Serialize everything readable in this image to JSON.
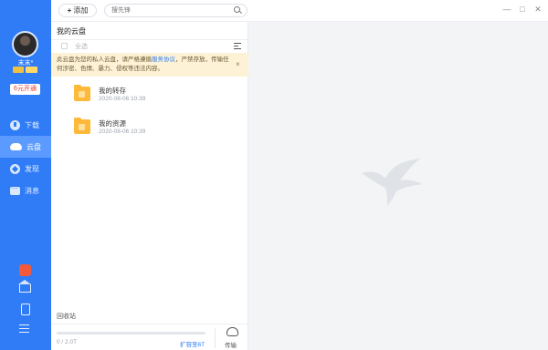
{
  "window": {
    "minimize_glyph": "—",
    "maximize_glyph": "□",
    "close_glyph": "✕"
  },
  "toolbar": {
    "add_label": "添加",
    "search_placeholder": "搜先锋"
  },
  "user": {
    "name": "末末*",
    "open_vip_label": "6元开通"
  },
  "sidebar": {
    "items": [
      {
        "label": "下载",
        "icon": "download-icon",
        "active": false
      },
      {
        "label": "云盘",
        "icon": "cloud-icon",
        "active": true
      },
      {
        "label": "发现",
        "icon": "discover-icon",
        "active": false
      },
      {
        "label": "消息",
        "icon": "message-icon",
        "active": false
      }
    ],
    "bottom_icons": [
      "gift-icon",
      "crown-icon",
      "phone-icon",
      "menu-icon"
    ]
  },
  "panel": {
    "title": "我的云盘",
    "select_all_label": "全选",
    "notice": {
      "text_before": "此云盘为您的私人云盘，请严格遵循",
      "link_text": "服务协议",
      "text_after": "，严禁存放，传输任何涉密、色情、暴力、侵权等违法内容。",
      "close_glyph": "×"
    },
    "files": [
      {
        "name": "我的转存",
        "date": "2020-08-06 10:39"
      },
      {
        "name": "我的资源",
        "date": "2020-08-06 10:39"
      }
    ],
    "trash_label": "回收站",
    "usage_text": "0 / 2.0T",
    "usage_fraction": 0,
    "expand_label": "扩容至6T",
    "transfer_label": "传输"
  },
  "colors": {
    "sidebar_blue": "#2f7cf6",
    "active_nav": "#5b9bff",
    "folder": "#ffb93a",
    "notice_bg": "#fdf2d5",
    "link": "#2f7cf6"
  }
}
